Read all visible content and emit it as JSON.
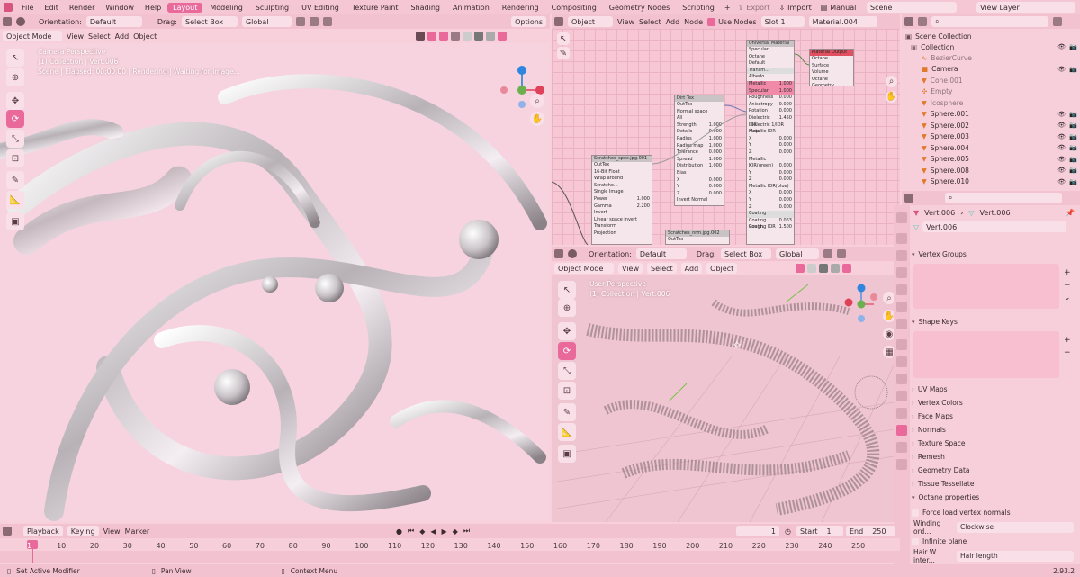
{
  "topbar": {
    "menus": [
      "File",
      "Edit",
      "Render",
      "Window",
      "Help"
    ],
    "workspaces": [
      "Layout",
      "Modeling",
      "Sculpting",
      "UV Editing",
      "Texture Paint",
      "Shading",
      "Animation",
      "Rendering",
      "Compositing",
      "Geometry Nodes",
      "Scripting"
    ],
    "active_workspace": "Layout",
    "export_label": "Export",
    "import_label": "Import",
    "manual_label": "Manual",
    "scene_label": "Scene",
    "view_layer_label": "View Layer"
  },
  "viewport_left": {
    "orientation_label": "Orientation:",
    "orientation_value": "Default",
    "drag_label": "Drag:",
    "drag_value": "Select Box",
    "transform_value": "Global",
    "options_label": "Options",
    "mode": "Object Mode",
    "menus": [
      "View",
      "Select",
      "Add",
      "Object"
    ],
    "overlay_lines": [
      "Camera Perspective",
      "(1) Collection | Vert.006",
      "Scene | Elapsed: 00:00.00 | Rendering | Waiting for image..."
    ]
  },
  "node_editor": {
    "type_value": "Object",
    "menus": [
      "View",
      "Select",
      "Add",
      "Node"
    ],
    "use_nodes_label": "Use Nodes",
    "slot_value": "Slot 1",
    "material_value": "Material.004",
    "nodes": {
      "universal": {
        "title": "Universal Material",
        "rows": [
          "Specular",
          "Octane",
          "Default",
          "Transm...",
          "Albedo",
          "Metallic",
          "Specular",
          "Roughness",
          "Anisotropy",
          "Rotation",
          "Dielectric IOR",
          "Dielectric 1/IOR map",
          "Metallic IOR",
          "X",
          "Y",
          "Z",
          "Metallic IOR(green)",
          "X",
          "Y",
          "Z",
          "Metallic IOR(blue)",
          "X",
          "Y",
          "Z",
          "Coating",
          "Coating Rough.",
          "Coating IOR"
        ],
        "values": [
          "",
          "",
          "",
          "",
          "",
          "1.000",
          "1.000",
          "0.000",
          "0.000",
          "0.000",
          "1.450",
          "",
          "",
          "0.000",
          "0.000",
          "0.000",
          "",
          "0.000",
          "0.000",
          "0.000",
          "",
          "0.000",
          "0.000",
          "0.000",
          "",
          "0.063",
          "1.500"
        ]
      },
      "output": {
        "title": "Material Output",
        "rows": [
          "Octane",
          "Surface",
          "Volume",
          "Octane Geometry"
        ]
      },
      "dirt": {
        "title": "Dirt Tex",
        "rows": [
          "OutTex",
          "Normal space",
          "All",
          "Strength",
          "Details",
          "Radius",
          "Radius map",
          "Tolerance",
          "Spread",
          "Distribution",
          "Bias",
          "X",
          "Y",
          "Z",
          "Invert Normal"
        ],
        "values": [
          "",
          "",
          "",
          "1.000",
          "0.000",
          "1.000",
          "1.000",
          "0.000",
          "1.000",
          "1.000",
          "",
          "0.000",
          "0.000",
          "0.000",
          ""
        ]
      },
      "scratch": {
        "title": "Scratches_spec.jpg.001",
        "rows": [
          "OutTex",
          "16-Bit Float",
          "Wrap around",
          "Scratche...",
          "Single Image",
          "Power",
          "Gamma",
          "Invert",
          "Linear space invert",
          "Transform",
          "Projection"
        ],
        "values": [
          "",
          "",
          "",
          "",
          "",
          "1.000",
          "2.200",
          "",
          "",
          "",
          ""
        ]
      },
      "scratch2": {
        "title": "Scratches_nrm.jpg.002",
        "rows": [
          "OutTex"
        ]
      }
    }
  },
  "viewport_right": {
    "orientation_label": "Orientation:",
    "orientation_value": "Default",
    "drag_label": "Drag:",
    "drag_value": "Select Box",
    "transform_value": "Global",
    "mode": "Object Mode",
    "menus": [
      "View",
      "Select",
      "Add",
      "Object"
    ],
    "overlay_lines": [
      "User Perspective",
      "(1) Collection | Vert.006"
    ]
  },
  "outliner": {
    "root": "Scene Collection",
    "collection": "Collection",
    "items": [
      "BezierCurve",
      "Camera",
      "Cone.001",
      "Empty",
      "Icosphere",
      "Sphere.001",
      "Sphere.002",
      "Sphere.003",
      "Sphere.004",
      "Sphere.005",
      "Sphere.008",
      "Sphere.010"
    ]
  },
  "properties": {
    "breadcrumb": [
      "Vert.006",
      "Vert.006"
    ],
    "mesh_name": "Vert.006",
    "panels": [
      "Vertex Groups",
      "Shape Keys",
      "UV Maps",
      "Vertex Colors",
      "Face Maps",
      "Normals",
      "Texture Space",
      "Remesh",
      "Geometry Data",
      "Tissue Tessellate",
      "Octane properties"
    ],
    "force_load_label": "Force load vertex normals",
    "winding_label": "Winding ord...",
    "winding_value": "Clockwise",
    "infinite_plane_label": "Infinite plane",
    "hair_label": "Hair W inter...",
    "hair_value": "Hair length"
  },
  "timeline": {
    "menus": [
      "Playback",
      "Keying",
      "View",
      "Marker"
    ],
    "current_frame": "1",
    "start_label": "Start",
    "start_value": "1",
    "end_label": "End",
    "end_value": "250",
    "ticks": [
      "1",
      "10",
      "20",
      "30",
      "40",
      "50",
      "60",
      "70",
      "80",
      "90",
      "100",
      "110",
      "120",
      "130",
      "140",
      "150",
      "160",
      "170",
      "180",
      "190",
      "200",
      "210",
      "220",
      "230",
      "240",
      "250"
    ]
  },
  "statusbar": {
    "items": [
      "Set Active Modifier",
      "Pan View",
      "Context Menu"
    ],
    "version": "2.93.2"
  },
  "colors": {
    "accent": "#e8699a",
    "background": "#f7d0dc",
    "header": "#f3c2d1"
  }
}
